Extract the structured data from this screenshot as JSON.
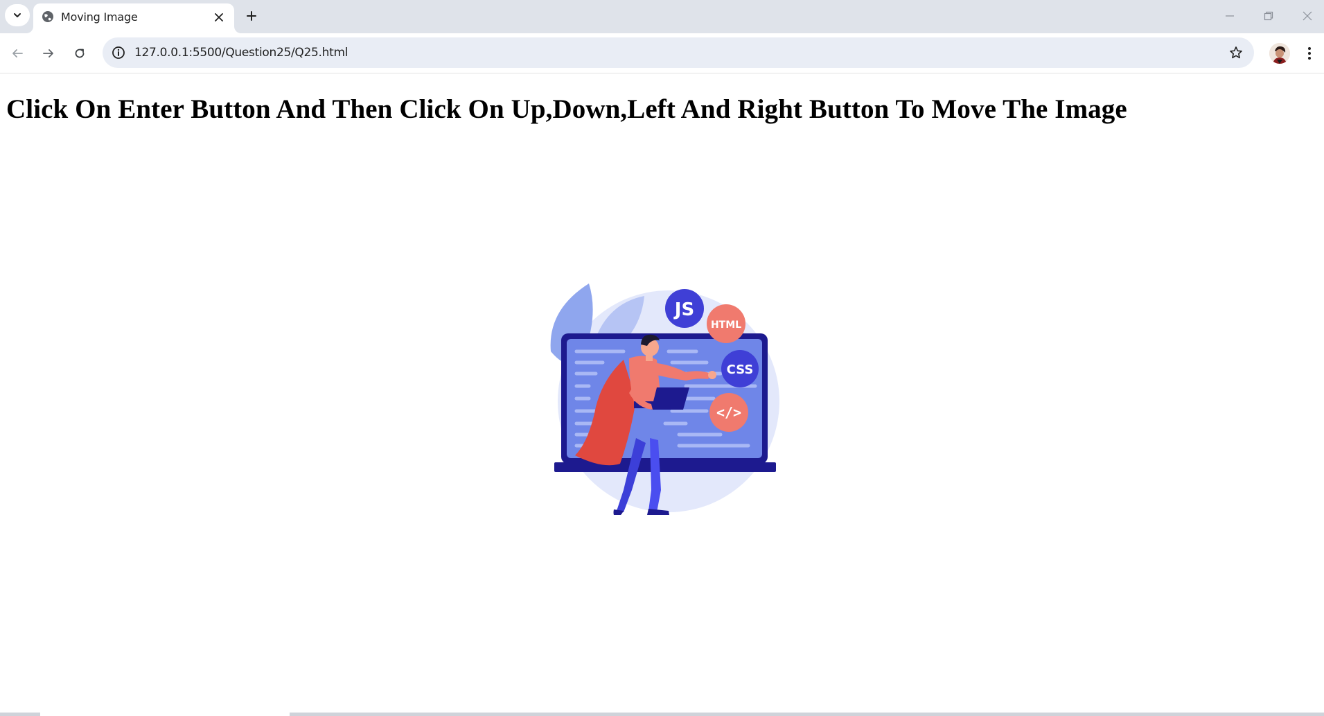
{
  "browser": {
    "tab": {
      "title": "Moving Image"
    },
    "url": "127.0.0.1:5500/Question25/Q25.html"
  },
  "page": {
    "heading": "Click On Enter Button And Then Click On Up,Down,Left And Right Button To Move The Image",
    "image": {
      "badges": {
        "js": "JS",
        "html": "HTML",
        "css": "CSS",
        "code": "</>"
      }
    }
  },
  "colors": {
    "accent_blue": "#3f3fd6",
    "accent_salmon": "#f07a6e",
    "screen": "#6f86e8",
    "frame": "#1d1a8f",
    "bg_circle": "#e3e8fb"
  }
}
